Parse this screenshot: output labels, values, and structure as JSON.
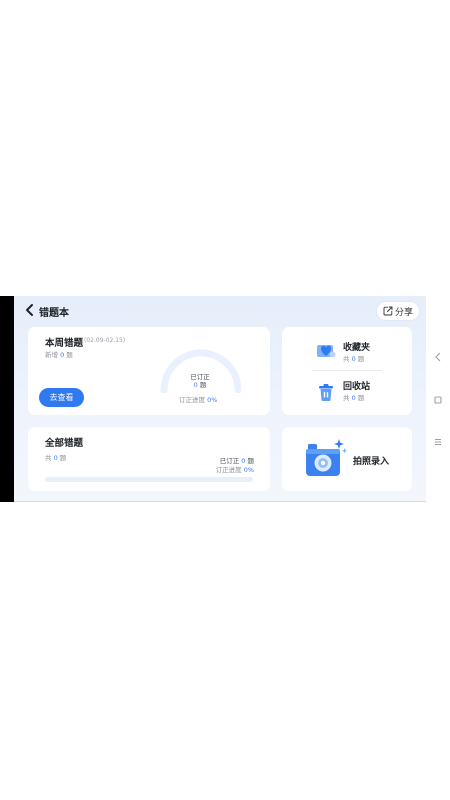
{
  "header": {
    "title": "错题本",
    "share_label": "分享"
  },
  "weekly": {
    "title": "本周错题",
    "date_range": "(02.09-02.15)",
    "added_prefix": "新增",
    "added_count": "0",
    "added_unit": "题",
    "view_button": "去查看",
    "corrected_label": "已订正",
    "corrected_count": "0",
    "corrected_unit": "题",
    "progress_label": "订正进度",
    "progress_value": "0%",
    "progress_fraction": 0
  },
  "favorites": {
    "title": "收藏夹",
    "count_prefix": "共",
    "count": "0",
    "count_unit": "题"
  },
  "recycle": {
    "title": "回收站",
    "count_prefix": "共",
    "count": "0",
    "count_unit": "题"
  },
  "all": {
    "title": "全部错题",
    "count_prefix": "共",
    "count": "0",
    "count_unit": "题",
    "corrected_label": "已订正",
    "corrected_count": "0",
    "corrected_unit": "题",
    "progress_label": "订正进度",
    "progress_value": "0%",
    "progress_fraction": 0
  },
  "photo": {
    "label": "拍照录入"
  },
  "colors": {
    "accent": "#2f7af0",
    "progress_track": "#e8eefc"
  },
  "icons": {
    "back": "chevron-left-icon",
    "share": "share-icon",
    "favorites": "heart-folder-icon",
    "recycle": "trash-icon",
    "camera": "camera-icon",
    "nav_back": "nav-back-icon",
    "nav_home": "nav-home-icon",
    "nav_menu": "nav-menu-icon"
  }
}
